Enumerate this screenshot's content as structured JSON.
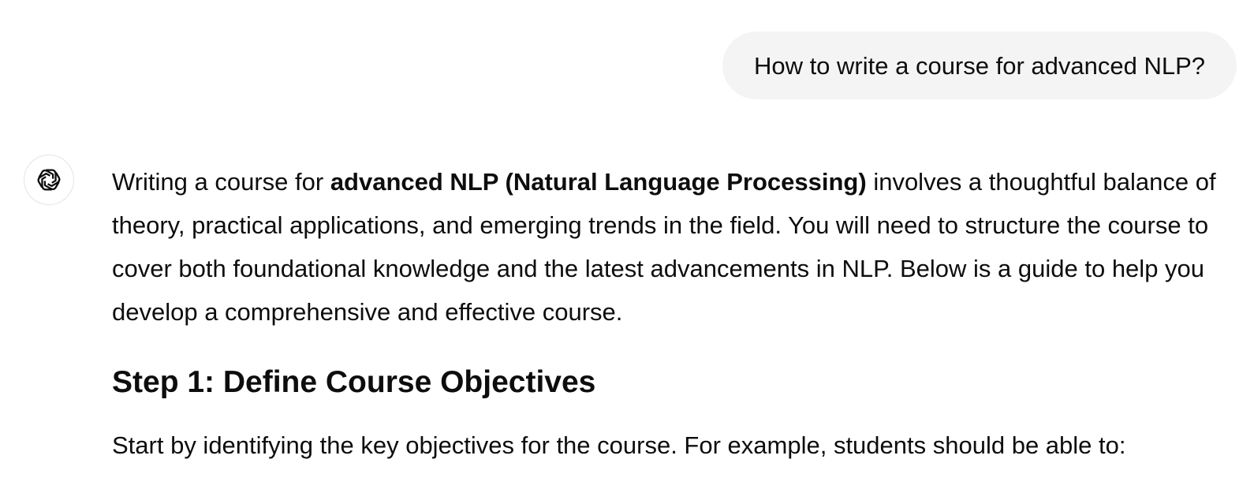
{
  "user_message": {
    "text": "How to write a course for advanced NLP?"
  },
  "assistant_message": {
    "avatar_icon": "openai-logo-icon",
    "intro_prefix": "Writing a course for ",
    "intro_bold": "advanced NLP (Natural Language Processing)",
    "intro_suffix": " involves a thoughtful balance of theory, practical applications, and emerging trends in the field. You will need to structure the course to cover both foundational knowledge and the latest advancements in NLP. Below is a guide to help you develop a comprehensive and effective course.",
    "step1_heading": "Step 1: Define Course Objectives",
    "step1_text": "Start by identifying the key objectives for the course. For example, students should be able to:"
  },
  "colors": {
    "user_bubble_bg": "#f4f4f4",
    "text": "#0d0d0d",
    "avatar_border": "#e3e3e3"
  }
}
